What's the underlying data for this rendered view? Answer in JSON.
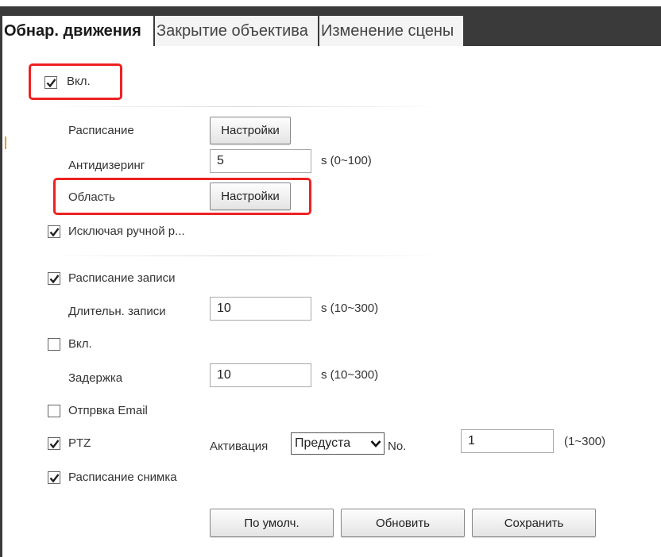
{
  "colors": {
    "highlight": "#ee2222",
    "tabbar": "#3a3a3a",
    "check": "#222222"
  },
  "tabs": [
    {
      "label": "Обнар. движения",
      "active": true
    },
    {
      "label": "Закрытие объектива",
      "active": false
    },
    {
      "label": "Изменение сцены",
      "active": false
    }
  ],
  "enable": {
    "label": "Вкл.",
    "checked": true
  },
  "schedule": {
    "label": "Расписание",
    "button": "Настройки"
  },
  "antidither": {
    "label": "Антидизеринг",
    "value": "5",
    "range": "s (0~100)"
  },
  "area": {
    "label": "Область",
    "button": "Настройки"
  },
  "exclude_manual": {
    "label": "Исключая ручной р...",
    "checked": true
  },
  "record_schedule": {
    "label": "Расписание записи",
    "checked": true
  },
  "record_duration": {
    "label": "Длительн. записи",
    "value": "10",
    "range": "s (10~300)"
  },
  "relay": {
    "label": "Вкл.",
    "checked": false
  },
  "delay": {
    "label": "Задержка",
    "value": "10",
    "range": "s (10~300)"
  },
  "email": {
    "label": "Отпрвка Email",
    "checked": false
  },
  "ptz": {
    "label": "PTZ",
    "checked": true,
    "activation_label": "Активация",
    "activation_value": "Предуста",
    "no_label": "No.",
    "no_value": "1",
    "no_range": "(1~300)"
  },
  "snapshot_schedule": {
    "label": "Расписание снимка",
    "checked": true
  },
  "buttons": {
    "default": "По умолч.",
    "refresh": "Обновить",
    "save": "Сохранить"
  }
}
